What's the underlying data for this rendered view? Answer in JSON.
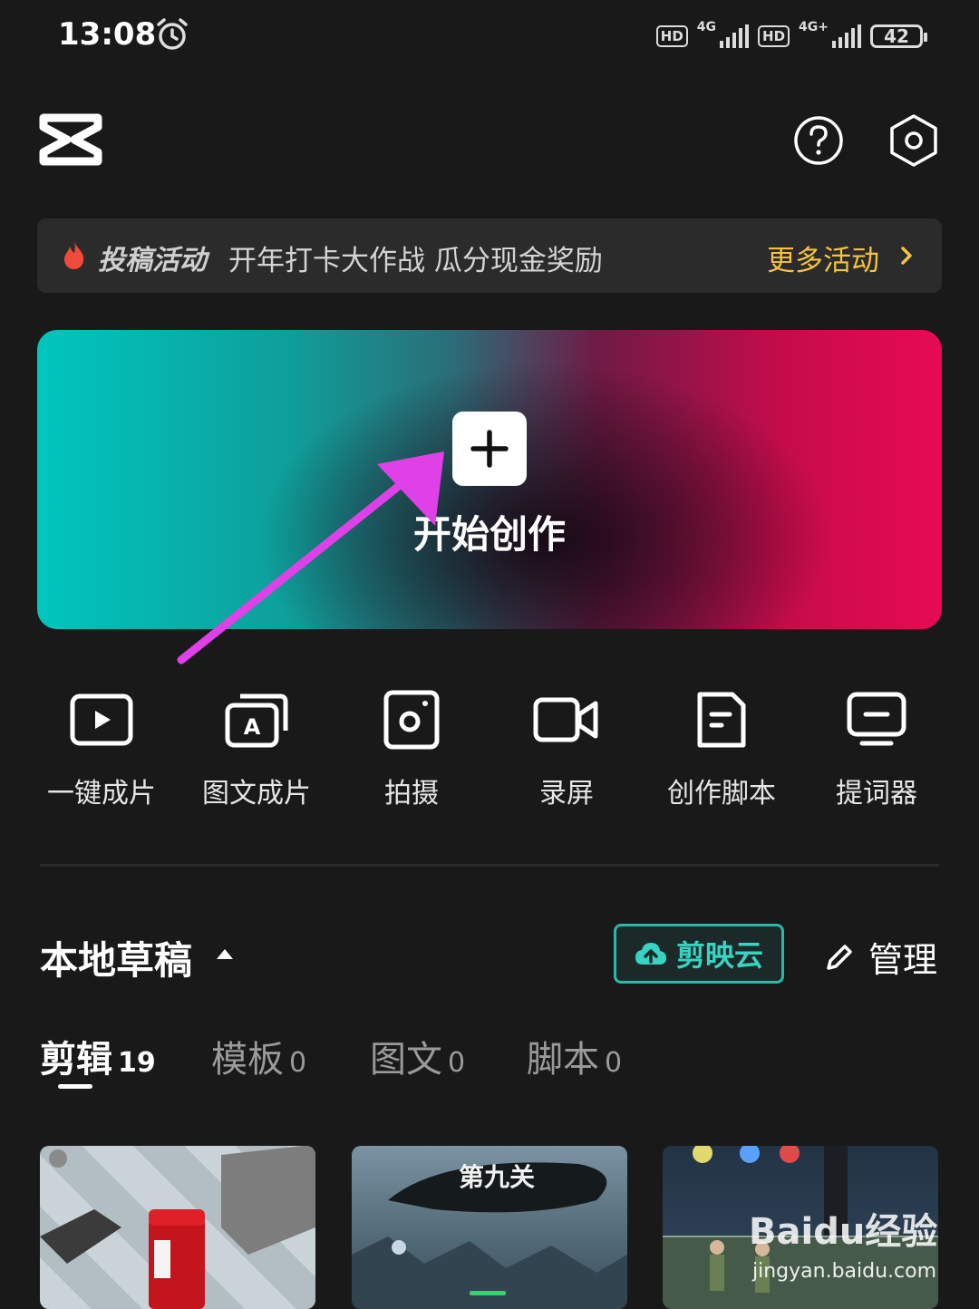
{
  "status": {
    "time": "13:08",
    "hd1": "HD",
    "net1": "4G",
    "hd2": "HD",
    "net2": "4G+",
    "battery": "42"
  },
  "header": {
    "logo_icon": "capcut-logo-icon",
    "help_icon": "help-icon",
    "settings_icon": "settings-icon"
  },
  "banner": {
    "tag": "投稿活动",
    "text": "开年打卡大作战 瓜分现金奖励",
    "more": "更多活动",
    "accent": "#f5c242"
  },
  "hero": {
    "label": "开始创作",
    "annotation_color": "#e040e8"
  },
  "tools": [
    {
      "label": "一键成片",
      "icon": "play-icon"
    },
    {
      "label": "图文成片",
      "icon": "text-to-video-icon"
    },
    {
      "label": "拍摄",
      "icon": "camera-icon"
    },
    {
      "label": "录屏",
      "icon": "screen-record-icon"
    },
    {
      "label": "创作脚本",
      "icon": "script-icon"
    },
    {
      "label": "提词器",
      "icon": "teleprompter-icon"
    }
  ],
  "drafts": {
    "title": "本地草稿",
    "cloud_label": "剪映云",
    "manage_label": "管理",
    "accent": "#38d3c3"
  },
  "tabs": [
    {
      "name": "剪辑",
      "count": "19",
      "active": true
    },
    {
      "name": "模板",
      "count": "0",
      "active": false
    },
    {
      "name": "图文",
      "count": "0",
      "active": false
    },
    {
      "name": "脚本",
      "count": "0",
      "active": false
    }
  ],
  "thumbnails": [
    {
      "caption": ""
    },
    {
      "caption": "第九关"
    },
    {
      "caption": ""
    }
  ],
  "watermark": {
    "brand": "Baidu经验",
    "url": "jingyan.baidu.com"
  }
}
